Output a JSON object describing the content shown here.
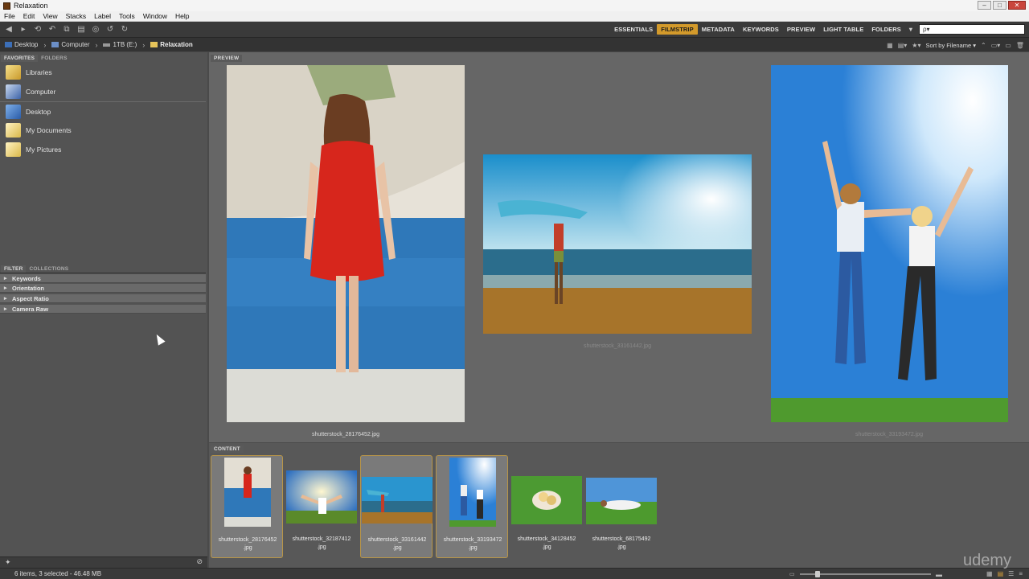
{
  "window": {
    "title": "Relaxation"
  },
  "menu": [
    "File",
    "Edit",
    "View",
    "Stacks",
    "Label",
    "Tools",
    "Window",
    "Help"
  ],
  "workspaces": {
    "items": [
      "ESSENTIALS",
      "FILMSTRIP",
      "METADATA",
      "KEYWORDS",
      "PREVIEW",
      "LIGHT TABLE",
      "FOLDERS"
    ],
    "active": "FILMSTRIP",
    "accent": "#d39a2b"
  },
  "search": {
    "placeholder": "ρ▾"
  },
  "path": {
    "crumbs": [
      "Desktop",
      "Computer",
      "1TB (E:)",
      "Relaxation"
    ]
  },
  "sort": {
    "label": "Sort by Filename ▾"
  },
  "panels": {
    "favorites_tab": "FAVORITES",
    "folders_tab": "FOLDERS",
    "filter_tab": "FILTER",
    "collections_tab": "COLLECTIONS",
    "preview_tab": "PREVIEW",
    "content_tab": "CONTENT"
  },
  "favorites": [
    {
      "label": "Libraries",
      "icon": "libraries-icon"
    },
    {
      "label": "Computer",
      "icon": "computer-icon"
    },
    {
      "label": "Desktop",
      "icon": "desktop-icon"
    },
    {
      "label": "My Documents",
      "icon": "documents-icon"
    },
    {
      "label": "My Pictures",
      "icon": "pictures-icon"
    }
  ],
  "filters": [
    "Keywords",
    "Orientation",
    "Aspect Ratio",
    "Camera Raw"
  ],
  "preview": {
    "captions": [
      "shutterstock_28176452.jpg",
      "shutterstock_33161442.jpg",
      "shutterstock_33193472.jpg"
    ]
  },
  "content": {
    "thumbs": [
      {
        "name": "shutterstock_28176452",
        "ext": ".jpg",
        "selected": true
      },
      {
        "name": "shutterstock_32187412",
        "ext": ".jpg",
        "selected": false
      },
      {
        "name": "shutterstock_33161442",
        "ext": ".jpg",
        "selected": true
      },
      {
        "name": "shutterstock_33193472",
        "ext": ".jpg",
        "selected": true
      },
      {
        "name": "shutterstock_34128452",
        "ext": ".jpg",
        "selected": false
      },
      {
        "name": "shutterstock_68175492",
        "ext": ".jpg",
        "selected": false
      }
    ]
  },
  "status": {
    "text": "6 items, 3 selected - 46.48 MB"
  },
  "watermark": "udemy"
}
